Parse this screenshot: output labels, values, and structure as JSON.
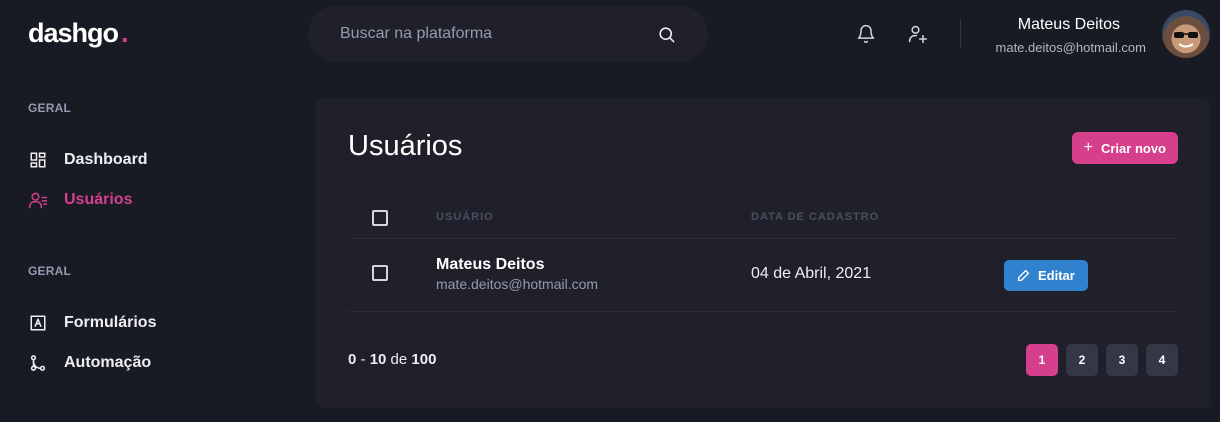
{
  "header": {
    "logo_text": "dashgo",
    "logo_dot": ".",
    "search_placeholder": "Buscar na plataforma",
    "profile": {
      "name": "Mateus Deitos",
      "email": "mate.deitos@hotmail.com"
    }
  },
  "sidebar": {
    "sections": [
      {
        "title": "GERAL",
        "items": [
          {
            "label": "Dashboard",
            "icon": "dashboard-icon",
            "active": false
          },
          {
            "label": "Usuários",
            "icon": "users-icon",
            "active": true
          }
        ]
      },
      {
        "title": "GERAL",
        "items": [
          {
            "label": "Formulários",
            "icon": "form-icon",
            "active": false
          },
          {
            "label": "Automação",
            "icon": "git-branch-icon",
            "active": false
          }
        ]
      }
    ]
  },
  "main": {
    "title": "Usuários",
    "create_button": {
      "icon": "+",
      "label": "Criar novo"
    },
    "table": {
      "headers": [
        "USUÁRIO",
        "DATA DE CADASTRO"
      ],
      "rows": [
        {
          "name": "Mateus Deitos",
          "email": "mate.deitos@hotmail.com",
          "date": "04 de Abril, 2021",
          "action": "Editar"
        }
      ]
    },
    "pagination": {
      "from": "0",
      "sep": " - ",
      "to": "10",
      "de": " de ",
      "total": "100",
      "pages": [
        "1",
        "2",
        "3",
        "4"
      ],
      "current": "1"
    }
  },
  "colors": {
    "accent": "#d53f8c",
    "edit": "#3182ce",
    "background": "#181b23",
    "card": "#1f2029"
  }
}
